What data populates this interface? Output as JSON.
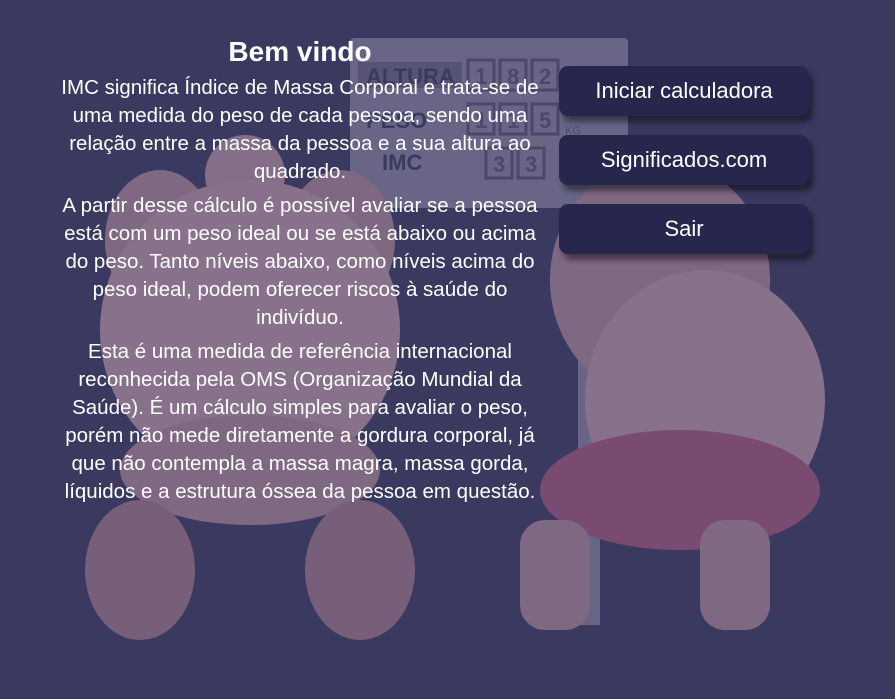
{
  "header": {
    "title": "Bem vindo"
  },
  "content": {
    "paragraphs": [
      "IMC significa Índice de Massa Corporal e trata-se de uma medida do peso de cada pessoa, sendo uma relação entre a massa da pessoa e a sua altura ao quadrado.",
      "A partir desse cálculo é possível avaliar se a pessoa está com um peso ideal ou se está abaixo ou acima do peso. Tanto níveis abaixo, como níveis acima do peso ideal, podem oferecer riscos à saúde do indivíduo.",
      "Esta é uma medida de referência internacional reconhecida pela OMS (Organização Mundial da Saúde). É um cálculo simples para avaliar o peso, porém não mede diretamente a gordura corporal, já que não contempla a massa magra, massa gorda, líquidos e a estrutura óssea da pessoa em questão."
    ]
  },
  "menu": {
    "start_label": "Iniciar calculadora",
    "meanings_label": "Significados.com",
    "exit_label": "Sair"
  },
  "illustration": {
    "scale_labels": [
      "ALTURA",
      "PESO",
      "IMC"
    ],
    "scale_digits": [
      "1",
      "8",
      "2",
      "1",
      "1",
      "5",
      "3",
      "3"
    ],
    "unit_label": "KG"
  },
  "colors": {
    "background": "#3a395f",
    "button": "#27264c",
    "text": "#ffffff"
  }
}
